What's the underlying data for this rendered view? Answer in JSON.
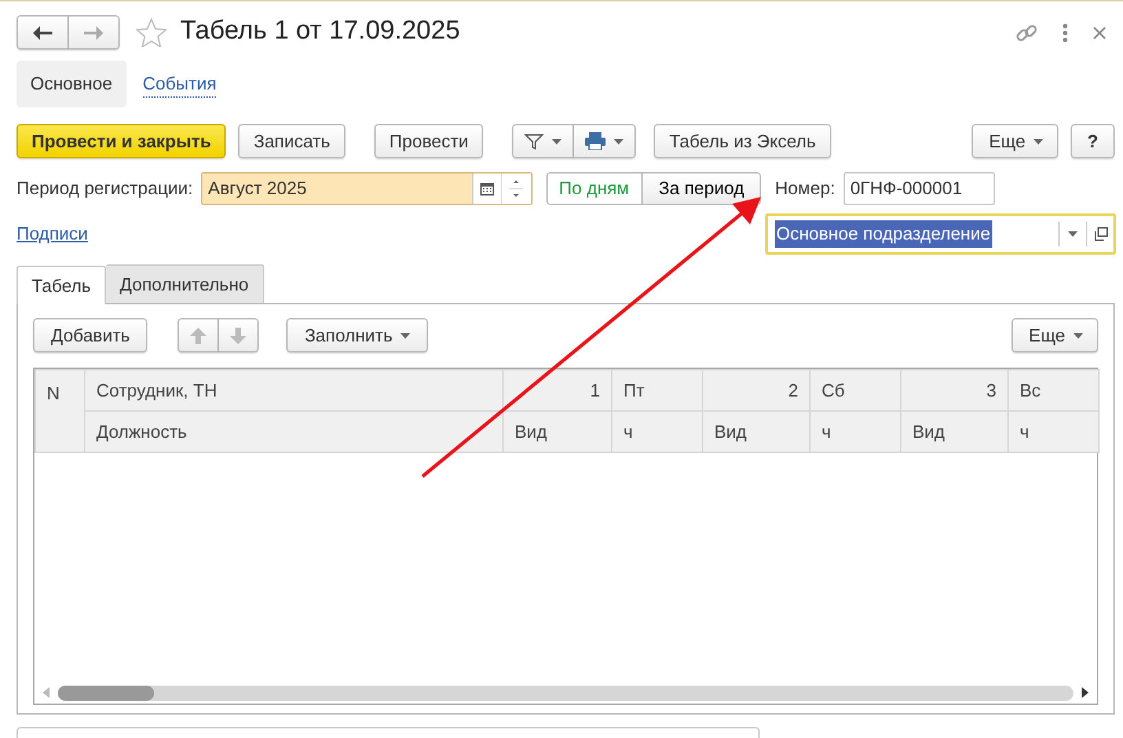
{
  "nav": {
    "back_enabled": true,
    "forward_enabled": false
  },
  "starred": false,
  "title": "Табель 1 от 17.09.2025",
  "sections": [
    {
      "label": "Основное",
      "selected": true
    },
    {
      "label": "События",
      "selected": false
    }
  ],
  "toolbar": [
    {
      "kind": "primary",
      "label": "Провести и закрыть"
    },
    {
      "kind": "button",
      "label": "Записать"
    },
    {
      "kind": "button",
      "label": "Провести"
    },
    {
      "kind": "filter-print"
    },
    {
      "kind": "button",
      "label": "Табель из Эксель"
    },
    {
      "kind": "menu",
      "label": "Еще"
    },
    {
      "kind": "help",
      "label": "?"
    }
  ],
  "period": {
    "label": "Период регистрации:",
    "value": "Август 2025"
  },
  "mode": [
    {
      "label": "По дням",
      "selected": true
    },
    {
      "label": "За период",
      "selected": false
    }
  ],
  "number": {
    "label": "Номер:",
    "value": "0ГНФ-000001"
  },
  "signatures_link": "Подписи",
  "department": {
    "value": "Основное подразделение",
    "text_selected": true
  },
  "tabs": [
    {
      "label": "Табель",
      "selected": true
    },
    {
      "label": "Дополнительно",
      "selected": false
    }
  ],
  "table_toolbar": {
    "add": "Добавить",
    "move_disabled": true,
    "fill": "Заполнить",
    "more": "Еще"
  },
  "table": {
    "corner": "N",
    "row_1": [
      "Сотрудник, ТН",
      "1",
      "Пт",
      "2",
      "Сб",
      "3",
      "Вс"
    ],
    "row_2": [
      "Должность",
      "Вид",
      "ч",
      "Вид",
      "ч",
      "Вид",
      "ч"
    ]
  }
}
